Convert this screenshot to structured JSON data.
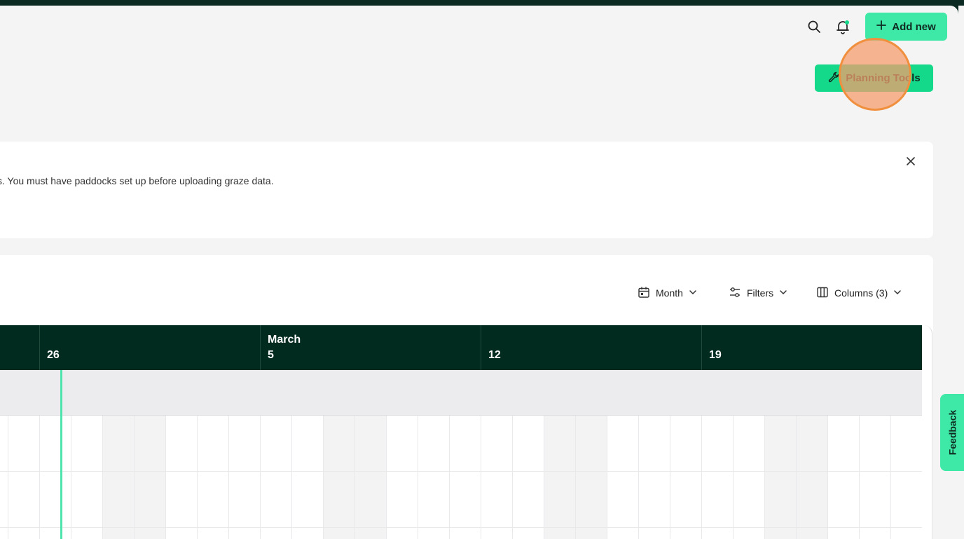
{
  "header": {
    "search_icon": "search-icon",
    "bell_icon": "bell-icon",
    "add_new_label": "Add new"
  },
  "planning_tools_label": "Planning Tools",
  "notice": {
    "text": "s. You must have paddocks set up before uploading graze data."
  },
  "toolbar": {
    "month_label": "Month",
    "filters_label": "Filters",
    "columns_label": "Columns (3)"
  },
  "calendar": {
    "weeks": [
      {
        "month": "",
        "day": "26"
      },
      {
        "month": "March",
        "day": "5"
      },
      {
        "month": "",
        "day": "12"
      },
      {
        "month": "",
        "day": "19"
      }
    ]
  },
  "feedback_label": "Feedback",
  "colors": {
    "accent": "#3ee8a6",
    "header_dark": "#022b1f",
    "highlight": "#f0903f"
  }
}
